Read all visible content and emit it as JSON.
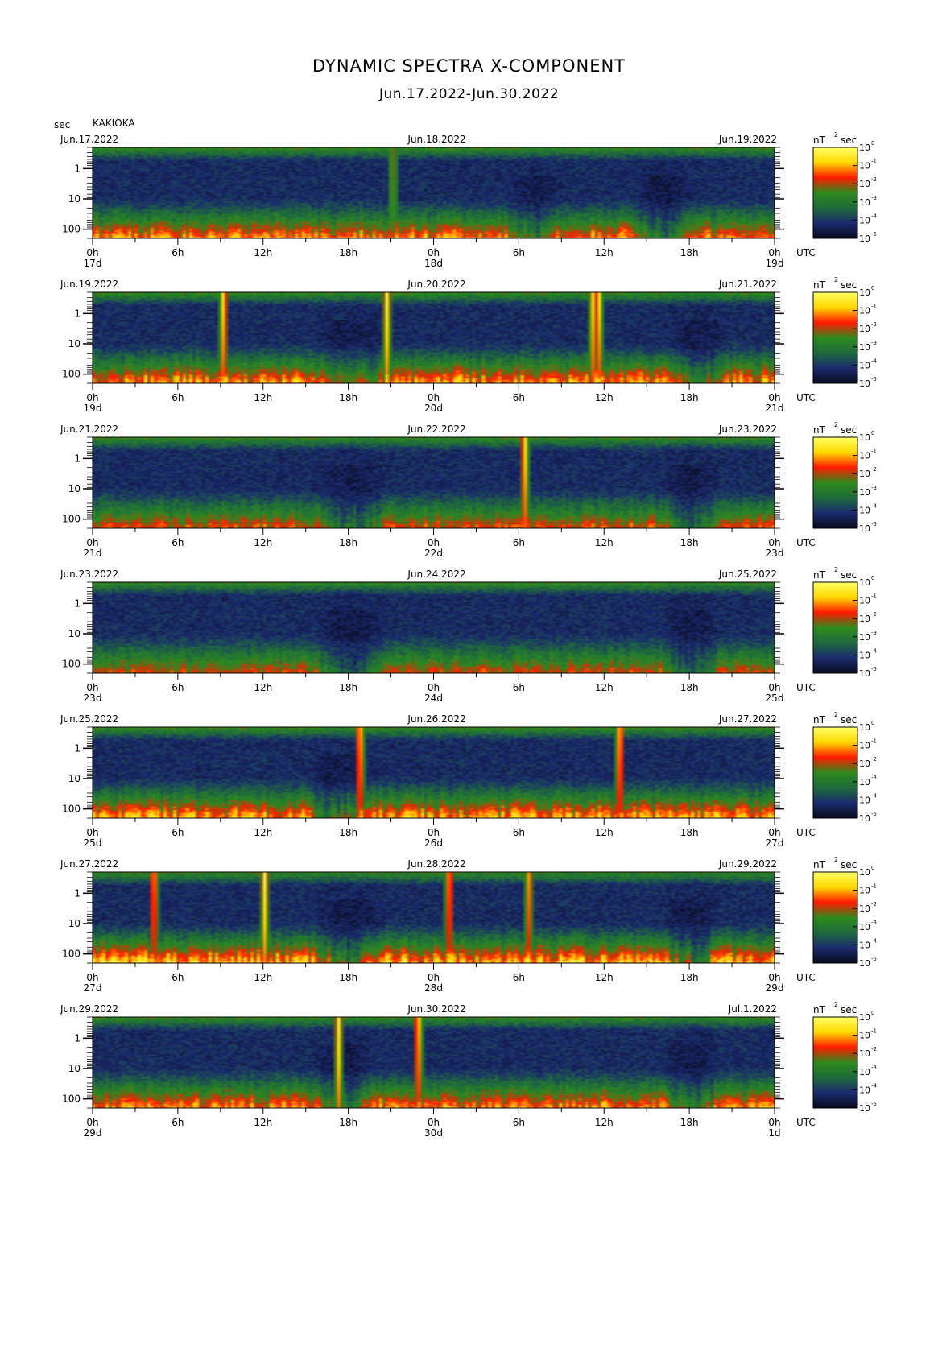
{
  "title": "DYNAMIC SPECTRA X-COMPONENT",
  "subtitle": "Jun.17.2022-Jun.30.2022",
  "y_unit": "sec",
  "station": "KAKIOKA",
  "colorbar_unit": "nT",
  "colorbar_unit_exp": "2",
  "colorbar_unit_suffix": "sec",
  "utc_label": "UTC",
  "colors": {
    "scale": [
      "#0a0a1e",
      "#1a2a6e",
      "#1f6a3c",
      "#2e8a1e",
      "#ff1a00",
      "#ffd800",
      "#ffff66"
    ]
  },
  "chart_data": {
    "type": "heatmap",
    "title": "DYNAMIC SPECTRA X-COMPONENT",
    "subtitle": "Jun.17.2022-Jun.30.2022",
    "ylabel": "sec",
    "y_scale": "log",
    "y_ticks": [
      "1",
      "10",
      "100"
    ],
    "x_ticks": [
      "0h",
      "6h",
      "12h",
      "18h",
      "0h",
      "6h",
      "12h",
      "18h",
      "0h"
    ],
    "x_axis_label": "UTC",
    "colorbar": {
      "unit": "nT^2 sec",
      "base": "10",
      "exponents": [
        "0",
        "-1",
        "-2",
        "-3",
        "-4",
        "-5"
      ]
    },
    "panels": [
      {
        "left_date": "Jun.17.2022",
        "mid_date": "Jun.18.2022",
        "right_date": "Jun.19.2022",
        "day_labels": [
          "17d",
          "18d",
          "19d"
        ],
        "spikes": [
          {
            "hour": 21.0,
            "top": 0.0,
            "intensity": 0.4
          }
        ],
        "quiet": [
          {
            "hour": 31.0,
            "w": 4,
            "depth": 0.5
          },
          {
            "hour": 40.0,
            "w": 4,
            "depth": 0.6
          }
        ],
        "activity": 0.45
      },
      {
        "left_date": "Jun.19.2022",
        "mid_date": "Jun.20.2022",
        "right_date": "Jun.21.2022",
        "day_labels": [
          "19d",
          "20d",
          "21d"
        ],
        "spikes": [
          {
            "hour": 9.1,
            "top": 0.0,
            "intensity": 1.0
          },
          {
            "hour": 20.6,
            "top": 0.0,
            "intensity": 1.0
          },
          {
            "hour": 35.1,
            "top": 0.0,
            "intensity": 0.9
          },
          {
            "hour": 35.5,
            "top": 0.0,
            "intensity": 1.0
          }
        ],
        "quiet": [
          {
            "hour": 18.0,
            "w": 5,
            "depth": 0.5
          },
          {
            "hour": 42.5,
            "w": 4,
            "depth": 0.55
          }
        ],
        "activity": 0.5
      },
      {
        "left_date": "Jun.21.2022",
        "mid_date": "Jun.22.2022",
        "right_date": "Jun.23.2022",
        "day_labels": [
          "21d",
          "22d",
          "23d"
        ],
        "spikes": [
          {
            "hour": 30.3,
            "top": 0.0,
            "intensity": 1.0
          }
        ],
        "quiet": [
          {
            "hour": 18.0,
            "w": 5,
            "depth": 0.55
          },
          {
            "hour": 42.0,
            "w": 4,
            "depth": 0.55
          }
        ],
        "activity": 0.35
      },
      {
        "left_date": "Jun.23.2022",
        "mid_date": "Jun.24.2022",
        "right_date": "Jun.25.2022",
        "day_labels": [
          "23d",
          "24d",
          "25d"
        ],
        "spikes": [],
        "quiet": [
          {
            "hour": 18.0,
            "w": 5,
            "depth": 0.6
          },
          {
            "hour": 42.0,
            "w": 4,
            "depth": 0.55
          }
        ],
        "activity": 0.3
      },
      {
        "left_date": "Jun.25.2022",
        "mid_date": "Jun.26.2022",
        "right_date": "Jun.27.2022",
        "day_labels": [
          "25d",
          "26d",
          "27d"
        ],
        "spikes": [
          {
            "hour": 18.7,
            "top": 0.0,
            "intensity": 1.0
          },
          {
            "hour": 37.0,
            "top": 0.0,
            "intensity": 1.0
          }
        ],
        "quiet": [
          {
            "hour": 17.0,
            "w": 4,
            "depth": 0.55
          }
        ],
        "activity": 0.5
      },
      {
        "left_date": "Jun.27.2022",
        "mid_date": "Jun.28.2022",
        "right_date": "Jun.29.2022",
        "day_labels": [
          "27d",
          "28d",
          "29d"
        ],
        "spikes": [
          {
            "hour": 4.2,
            "top": 0.0,
            "intensity": 0.9
          },
          {
            "hour": 12.0,
            "top": 0.0,
            "intensity": 1.0
          },
          {
            "hour": 25.0,
            "top": 0.0,
            "intensity": 0.9
          },
          {
            "hour": 30.6,
            "top": 0.0,
            "intensity": 0.8
          }
        ],
        "quiet": [
          {
            "hour": 18.0,
            "w": 5,
            "depth": 0.6
          },
          {
            "hour": 42.0,
            "w": 4,
            "depth": 0.55
          }
        ],
        "activity": 0.55
      },
      {
        "left_date": "Jun.29.2022",
        "mid_date": "Jun.30.2022",
        "right_date": "Jul.1.2022",
        "day_labels": [
          "29d",
          "30d",
          "1d"
        ],
        "spikes": [
          {
            "hour": 17.2,
            "top": 0.0,
            "intensity": 1.0
          },
          {
            "hour": 22.8,
            "top": 0.0,
            "intensity": 1.0
          }
        ],
        "quiet": [
          {
            "hour": 17.5,
            "w": 4,
            "depth": 0.6
          },
          {
            "hour": 42.0,
            "w": 4,
            "depth": 0.55
          }
        ],
        "activity": 0.45
      }
    ]
  }
}
